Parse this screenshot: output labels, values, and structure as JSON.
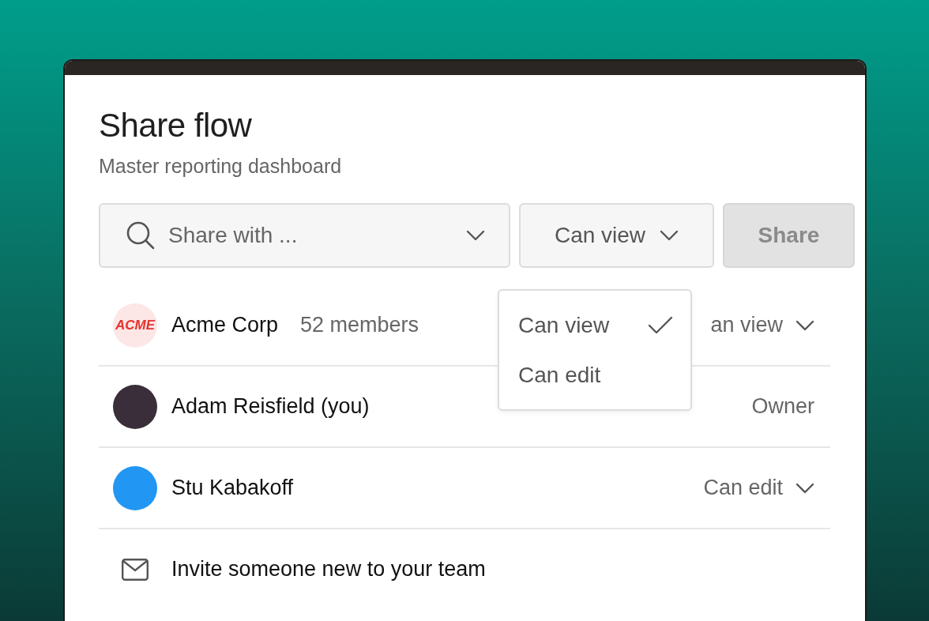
{
  "dialog": {
    "title": "Share flow",
    "subtitle": "Master reporting dashboard"
  },
  "share_bar": {
    "search": {
      "placeholder": "Share with ..."
    },
    "permission": "Can view",
    "share_button": {
      "label": "Share",
      "disabled": true
    }
  },
  "permission_menu": {
    "options": [
      {
        "label": "Can view",
        "selected": true
      },
      {
        "label": "Can edit",
        "selected": false
      }
    ]
  },
  "members": [
    {
      "kind": "org",
      "name": "Acme Corp",
      "logo_text": "ACME",
      "detail": "52 members",
      "role": "an view",
      "role_menu": true
    },
    {
      "kind": "user",
      "name": "Adam Reisfield (you)",
      "role": "Owner",
      "role_menu": false
    },
    {
      "kind": "user",
      "name": "Stu Kabakoff",
      "role": "Can edit",
      "role_menu": true
    },
    {
      "kind": "invite",
      "name": "Invite someone new to your team"
    }
  ]
}
